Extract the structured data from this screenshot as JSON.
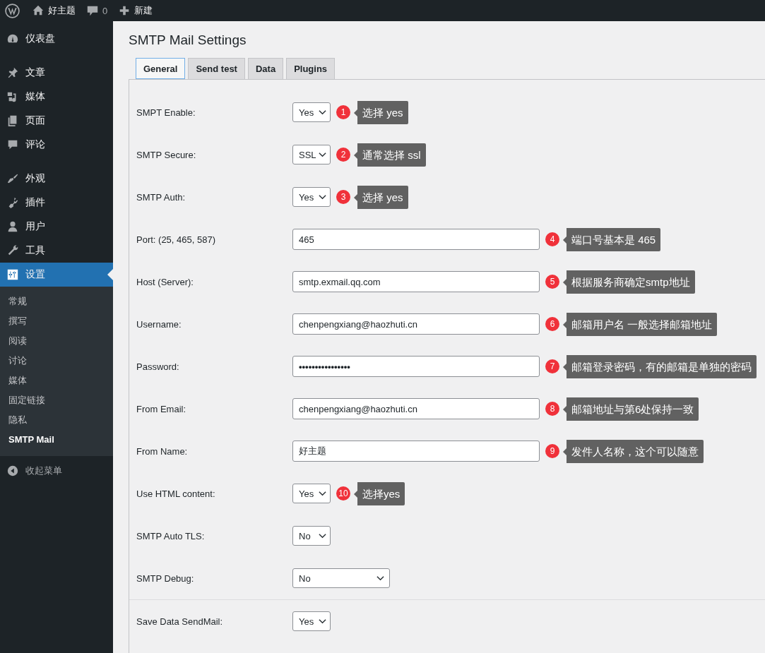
{
  "admin_bar": {
    "site_name": "好主题",
    "comments_count": "0",
    "new_label": "新建"
  },
  "sidebar": {
    "groups": [
      {
        "items": [
          {
            "label": "仪表盘",
            "selected": false
          }
        ]
      },
      {
        "items": [
          {
            "label": "文章",
            "selected": false
          },
          {
            "label": "媒体",
            "selected": false
          },
          {
            "label": "页面",
            "selected": false
          },
          {
            "label": "评论",
            "selected": false
          }
        ]
      },
      {
        "items": [
          {
            "label": "外观",
            "selected": false
          },
          {
            "label": "插件",
            "selected": false
          },
          {
            "label": "用户",
            "selected": false
          },
          {
            "label": "工具",
            "selected": false
          },
          {
            "label": "设置",
            "selected": true,
            "children": [
              {
                "label": "常规",
                "selected": false
              },
              {
                "label": "撰写",
                "selected": false
              },
              {
                "label": "阅读",
                "selected": false
              },
              {
                "label": "讨论",
                "selected": false
              },
              {
                "label": "媒体",
                "selected": false
              },
              {
                "label": "固定链接",
                "selected": false
              },
              {
                "label": "隐私",
                "selected": false
              },
              {
                "label": "SMTP Mail",
                "selected": true
              }
            ]
          }
        ]
      }
    ],
    "collapse_label": "收起菜单"
  },
  "page_title": "SMTP Mail Settings",
  "tabs": [
    {
      "label": "General",
      "selected": true
    },
    {
      "label": "Send test",
      "selected": false
    },
    {
      "label": "Data",
      "selected": false
    },
    {
      "label": "Plugins",
      "selected": false
    }
  ],
  "fields": [
    {
      "label": "SMPT Enable:",
      "kind": "select",
      "value": "Yes",
      "note": {
        "number": "1",
        "text": "选择 yes"
      }
    },
    {
      "label": "SMTP Secure:",
      "kind": "select",
      "value": "SSL",
      "note": {
        "number": "2",
        "text": "通常选择 ssl"
      }
    },
    {
      "label": "SMTP Auth:",
      "kind": "select",
      "value": "Yes",
      "note": {
        "number": "3",
        "text": "选择 yes"
      }
    },
    {
      "label": "Port: (25, 465, 587)",
      "kind": "text",
      "value": "465",
      "note": {
        "number": "4",
        "text": "端口号基本是 465"
      }
    },
    {
      "label": "Host (Server):",
      "kind": "text",
      "value": "smtp.exmail.qq.com",
      "note": {
        "number": "5",
        "text": "根据服务商确定smtp地址"
      }
    },
    {
      "label": "Username:",
      "kind": "text",
      "value": "chenpengxiang@haozhuti.cn",
      "note": {
        "number": "6",
        "text": "邮箱用户名 一般选择邮箱地址"
      }
    },
    {
      "label": "Password:",
      "kind": "password",
      "value": "••••••••••••••••",
      "note": {
        "number": "7",
        "text": "邮箱登录密码，有的邮箱是单独的密码"
      }
    },
    {
      "label": "From Email:",
      "kind": "text",
      "value": "chenpengxiang@haozhuti.cn",
      "note": {
        "number": "8",
        "text": "邮箱地址与第6处保持一致"
      }
    },
    {
      "label": "From Name:",
      "kind": "text",
      "value": "好主题",
      "note": {
        "number": "9",
        "text": "发件人名称，这个可以随意"
      }
    },
    {
      "label": "Use HTML content:",
      "kind": "select",
      "value": "Yes",
      "note": {
        "number": "10",
        "text": "选择yes"
      }
    },
    {
      "label": "SMTP Auto TLS:",
      "kind": "select",
      "value": "No"
    },
    {
      "label": "SMTP Debug:",
      "kind": "wideselect",
      "value": "No"
    },
    {
      "label": "Save Data SendMail:",
      "kind": "select",
      "value": "Yes",
      "divider_before": true
    }
  ]
}
